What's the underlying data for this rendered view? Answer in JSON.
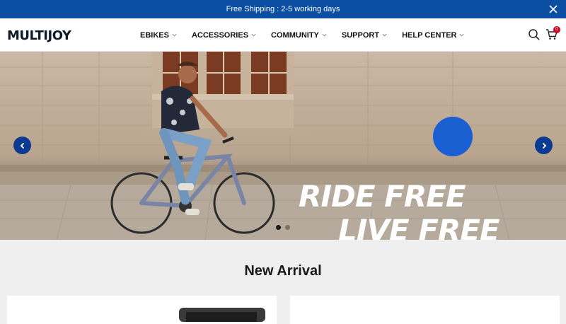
{
  "announcement": {
    "text": "Free Shipping : 2-5 working days"
  },
  "logo": {
    "text": "MULTIJOY"
  },
  "nav": {
    "items": [
      {
        "label": "EBIKES"
      },
      {
        "label": "ACCESSORIES"
      },
      {
        "label": "COMMUNITY"
      },
      {
        "label": "SUPPORT"
      },
      {
        "label": "HELP CENTER"
      }
    ]
  },
  "header_icons": [
    "search-icon",
    "cart-icon"
  ],
  "cart": {
    "count": "0"
  },
  "hero": {
    "headline_line1": "RIDE FREE",
    "headline_line2": "LIVE FREE",
    "slides_total": 2,
    "active_slide": 1
  },
  "section": {
    "title": "New Arrival"
  },
  "colors": {
    "brand_blue": "#0b4ea2",
    "arrow_blue": "#0b3b91",
    "badge_red": "#d0021b"
  }
}
